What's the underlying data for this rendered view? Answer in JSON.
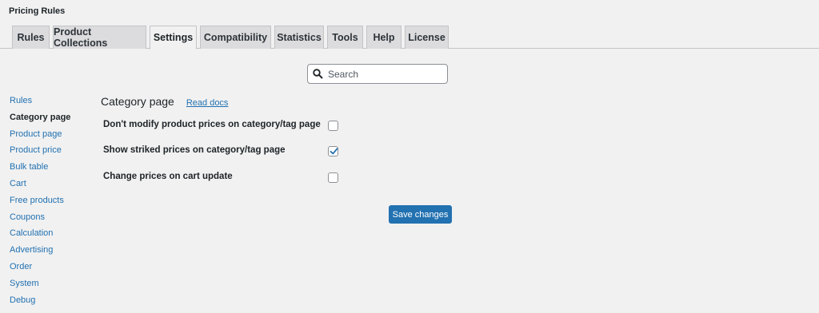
{
  "page": {
    "title": "Pricing Rules"
  },
  "tabs": [
    {
      "label": "Rules"
    },
    {
      "label": "Product Collections"
    },
    {
      "label": "Settings",
      "active": true
    },
    {
      "label": "Compatibility"
    },
    {
      "label": "Statistics"
    },
    {
      "label": "Tools"
    },
    {
      "label": "Help"
    },
    {
      "label": "License"
    }
  ],
  "search": {
    "placeholder": "Search",
    "value": ""
  },
  "sidenav": [
    {
      "label": "Rules"
    },
    {
      "label": "Category page",
      "current": true
    },
    {
      "label": "Product page"
    },
    {
      "label": "Product price"
    },
    {
      "label": "Bulk table"
    },
    {
      "label": "Cart"
    },
    {
      "label": "Free products"
    },
    {
      "label": "Coupons"
    },
    {
      "label": "Calculation"
    },
    {
      "label": "Advertising"
    },
    {
      "label": "Order"
    },
    {
      "label": "System"
    },
    {
      "label": "Debug"
    }
  ],
  "section": {
    "title": "Category page",
    "docs_link": "Read docs"
  },
  "options": [
    {
      "label": "Don't modify product prices on category/tag page",
      "checked": false
    },
    {
      "label": "Show striked prices on category/tag page",
      "checked": true
    },
    {
      "label": "Change prices on cart update",
      "checked": false
    }
  ],
  "actions": {
    "save_label": "Save changes"
  },
  "colors": {
    "accent": "#2271b1",
    "background": "#f1f1f1",
    "tab_bg": "#dcdcde"
  }
}
